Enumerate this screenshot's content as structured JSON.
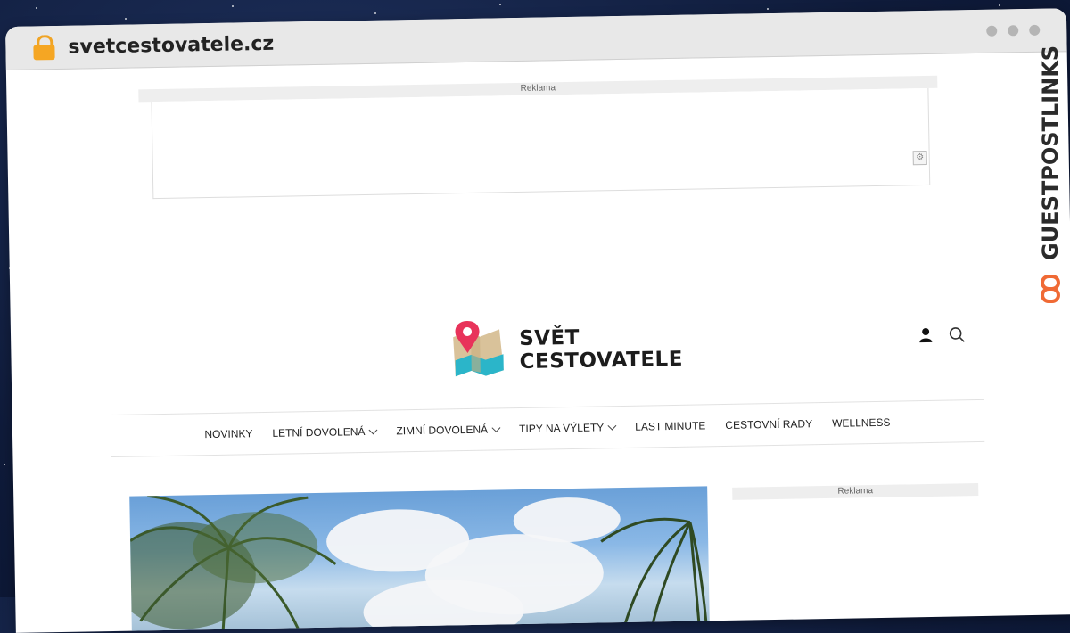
{
  "browser": {
    "url": "svetcestovatele.cz"
  },
  "ads": {
    "top_label": "Reklama",
    "sidebar_label": "Reklama"
  },
  "site": {
    "logo_line1": "SVĚT",
    "logo_line2": "CESTOVATELE",
    "brand_colors": {
      "pin": "#e8335a",
      "map_tan": "#d9c29a",
      "map_teal": "#2bb5c9"
    }
  },
  "header_icons": [
    "user-icon",
    "search-icon"
  ],
  "nav": {
    "items": [
      {
        "label": "NOVINKY",
        "dropdown": false
      },
      {
        "label": "LETNÍ DOVOLENÁ",
        "dropdown": true
      },
      {
        "label": "ZIMNÍ DOVOLENÁ",
        "dropdown": true
      },
      {
        "label": "TIPY NA VÝLETY",
        "dropdown": true
      },
      {
        "label": "LAST MINUTE",
        "dropdown": false
      },
      {
        "label": "CESTOVNÍ RADY",
        "dropdown": false
      },
      {
        "label": "WELLNESS",
        "dropdown": false
      }
    ]
  },
  "watermark": {
    "text": "GUESTPOSTLINKS",
    "color": "#2b2b2b",
    "accent": "#f06a35"
  }
}
